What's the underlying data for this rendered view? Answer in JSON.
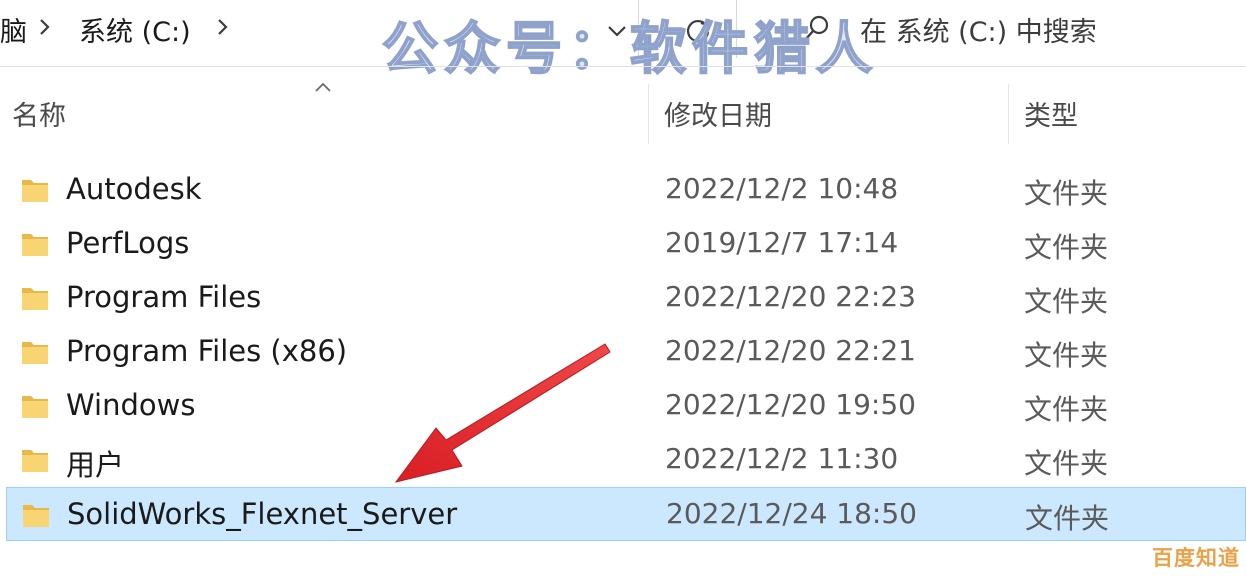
{
  "address_bar": {
    "breadcrumbs": [
      "脑",
      "系统 (C:)"
    ],
    "search_placeholder": "在 系统 (C:) 中搜索"
  },
  "watermark_text": "公众号：软件猎人",
  "columns": {
    "name": "名称",
    "date_modified": "修改日期",
    "type": "类型"
  },
  "rows": [
    {
      "name": "Autodesk",
      "date": "2022/12/2 10:48",
      "type": "文件夹",
      "selected": false
    },
    {
      "name": "PerfLogs",
      "date": "2019/12/7 17:14",
      "type": "文件夹",
      "selected": false
    },
    {
      "name": "Program Files",
      "date": "2022/12/20 22:23",
      "type": "文件夹",
      "selected": false
    },
    {
      "name": "Program Files (x86)",
      "date": "2022/12/20 22:21",
      "type": "文件夹",
      "selected": false
    },
    {
      "name": "Windows",
      "date": "2022/12/20 19:50",
      "type": "文件夹",
      "selected": false
    },
    {
      "name": "用户",
      "date": "2022/12/2 11:30",
      "type": "文件夹",
      "selected": false
    },
    {
      "name": "SolidWorks_Flexnet_Server",
      "date": "2022/12/24 18:50",
      "type": "文件夹",
      "selected": true
    }
  ],
  "corner_logo_text": "百度知道",
  "colors": {
    "selection_bg": "#cce8ff",
    "selection_border": "#99d1ff",
    "folder_yellow": "#f8d572",
    "annotation_arrow": "#e0252a"
  },
  "icons": {
    "folder": "folder-icon",
    "breadcrumb_separator": "chevron-right-icon",
    "dropdown": "chevron-down-icon",
    "refresh": "refresh-icon",
    "search": "search-icon",
    "sort": "sort-ascending-icon"
  }
}
